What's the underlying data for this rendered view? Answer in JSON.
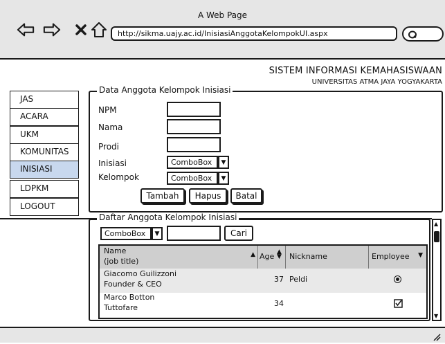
{
  "window": {
    "title": "A Web Page",
    "url": "http://sikma.uajy.ac.id/InisiasiAnggotaKelompokUI.aspx"
  },
  "header": {
    "title": "SISTEM INFORMASI KEMAHASISWAAN",
    "subtitle": "UNIVERSITAS ATMA JAYA YOGYAKARTA"
  },
  "sidebar": {
    "items": [
      {
        "label": "JAS"
      },
      {
        "label": "ACARA"
      },
      {
        "label": "UKM"
      },
      {
        "label": "KOMUNITAS"
      },
      {
        "label": "INISIASI",
        "active": true
      },
      {
        "label": "LDPKM"
      },
      {
        "label": "LOGOUT"
      }
    ]
  },
  "form": {
    "legend": "Data Anggota Kelompok Inisiasi",
    "npm_label": "NPM",
    "nama_label": "Nama",
    "prodi_label": "Prodi",
    "inisiasi_label": "Inisiasi",
    "inisiasi_value": "ComboBox",
    "kelompok_label": "Kelompok",
    "kelompok_value": "ComboBox",
    "tambah_label": "Tambah",
    "hapus_label": "Hapus",
    "batal_label": "Batal"
  },
  "list": {
    "legend": "Daftar Anggota Kelompok Inisiasi",
    "filter_value": "ComboBox",
    "cari_label": "Cari",
    "columns": {
      "name": "Name",
      "name_sub": "(job title)",
      "age": "Age",
      "nickname": "Nickname",
      "employee": "Employee"
    },
    "rows": [
      {
        "name": "Giacomo Guilizzoni",
        "title": "Founder & CEO",
        "age": "37",
        "nickname": "Peldi",
        "employee": "radio"
      },
      {
        "name": "Marco Botton",
        "title": "Tuttofare",
        "age": "34",
        "nickname": "",
        "employee": "checkbox"
      }
    ]
  },
  "icons": {
    "back": "back-arrow-icon",
    "forward": "forward-arrow-icon",
    "stop": "close-icon",
    "home": "home-icon",
    "search": "search-icon"
  },
  "colors": {
    "chrome": "#e6e6e6",
    "active_item": "#c8d8ee",
    "grid_header": "#cfcfcf",
    "grid_row_alt": "#e9e9e9"
  }
}
